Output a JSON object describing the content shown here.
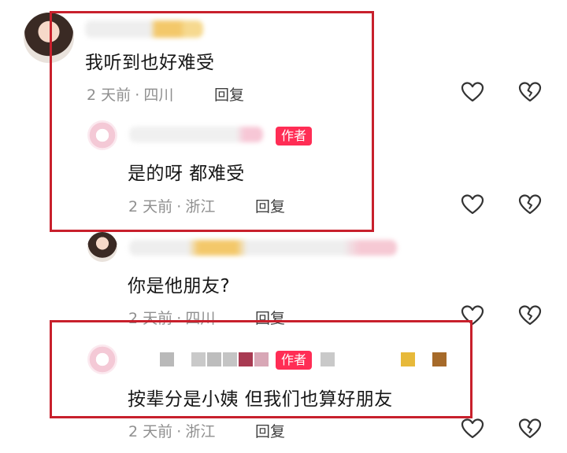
{
  "comments": [
    {
      "text": "我听到也好难受",
      "time": "2 天前",
      "sep": "·",
      "location": "四川",
      "reply": "回复"
    },
    {
      "text": "是的呀 都难受",
      "time": "2 天前",
      "sep": "·",
      "location": "浙江",
      "reply": "回复",
      "badge": "作者"
    },
    {
      "text": "你是他朋友?",
      "time": "2 天前",
      "sep": "·",
      "location": "四川",
      "reply": "回复"
    },
    {
      "text": "按辈分是小姨  但我们也算好朋友",
      "time": "2 天前",
      "sep": "·",
      "location": "浙江",
      "reply": "回复",
      "badge": "作者"
    }
  ],
  "icons": {
    "like": "heart-outline-icon",
    "dislike": "broken-heart-icon"
  },
  "colors": {
    "highlight_box": "#c8202c",
    "author_badge": "#ff2d55",
    "meta_text": "#8f8f8f"
  }
}
